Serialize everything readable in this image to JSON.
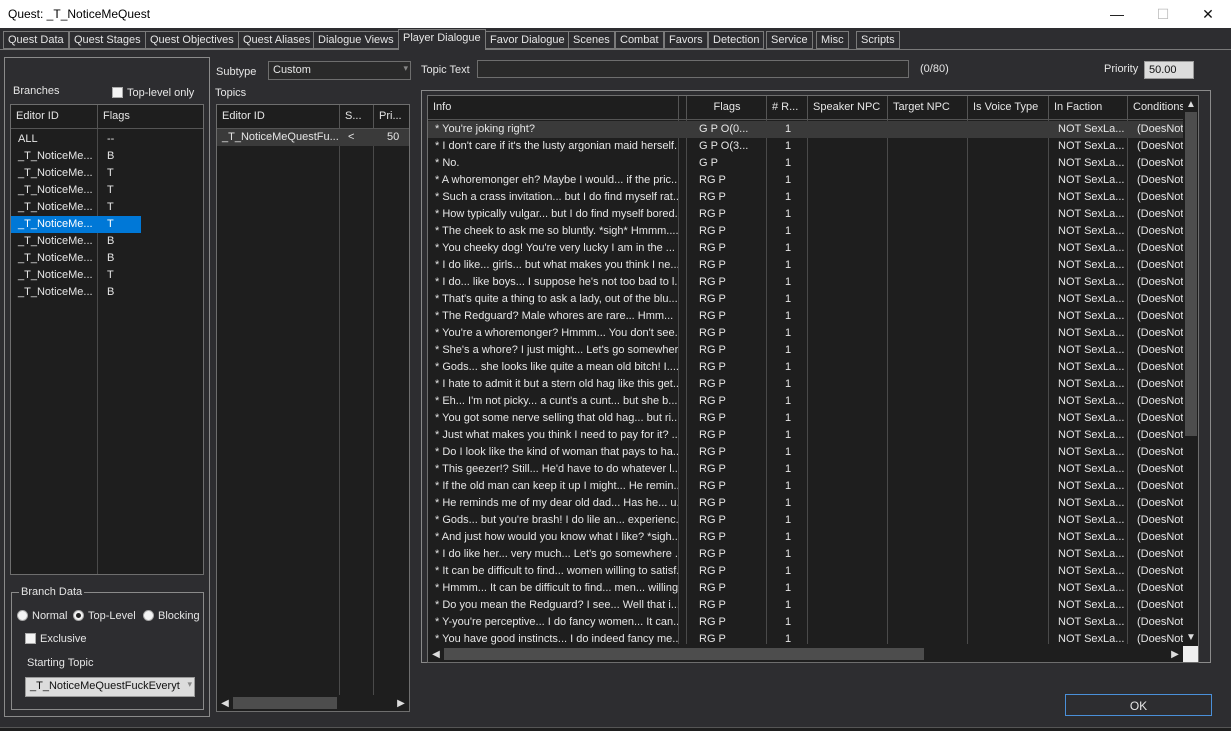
{
  "window": {
    "title": "Quest: _T_NoticeMeQuest",
    "minimize": "—",
    "maximize": "☐",
    "close": "✕"
  },
  "tabs": [
    {
      "label": "Quest Data"
    },
    {
      "label": "Quest Stages"
    },
    {
      "label": "Quest Objectives"
    },
    {
      "label": "Quest Aliases"
    },
    {
      "label": "Dialogue Views"
    },
    {
      "label": "Player Dialogue"
    },
    {
      "label": "Favor Dialogue"
    },
    {
      "label": "Scenes"
    },
    {
      "label": "Combat"
    },
    {
      "label": "Favors"
    },
    {
      "label": "Detection"
    },
    {
      "label": "Service"
    },
    {
      "label": "Misc"
    },
    {
      "label": "Scripts"
    }
  ],
  "branches": {
    "label": "Branches",
    "toplevel_only": "Top-level only",
    "headers": {
      "editor_id": "Editor ID",
      "flags": "Flags"
    },
    "rows": [
      {
        "id": "ALL",
        "flag": "--"
      },
      {
        "id": "_T_NoticeMe...",
        "flag": "B"
      },
      {
        "id": "_T_NoticeMe...",
        "flag": "T"
      },
      {
        "id": "_T_NoticeMe...",
        "flag": "T"
      },
      {
        "id": "_T_NoticeMe...",
        "flag": "T"
      },
      {
        "id": "_T_NoticeMe...",
        "flag": "T"
      },
      {
        "id": "_T_NoticeMe...",
        "flag": "B"
      },
      {
        "id": "_T_NoticeMe...",
        "flag": "B"
      },
      {
        "id": "_T_NoticeMe...",
        "flag": "T"
      },
      {
        "id": "_T_NoticeMe...",
        "flag": "B"
      }
    ],
    "selected_index": 5
  },
  "branch_data": {
    "label": "Branch Data",
    "normal": "Normal",
    "top_level": "Top-Level",
    "blocking": "Blocking",
    "exclusive": "Exclusive",
    "starting_topic_label": "Starting Topic",
    "starting_topic_value": "_T_NoticeMeQuestFuckEveryt"
  },
  "subtype": {
    "label": "Subtype",
    "value": "Custom"
  },
  "topic_text": {
    "label": "Topic Text",
    "value": "",
    "count": "(0/80)"
  },
  "priority": {
    "label": "Priority",
    "value": "50.00"
  },
  "topics": {
    "label": "Topics",
    "headers": {
      "editor_id": "Editor ID",
      "s": "S...",
      "pri": "Pri..."
    },
    "rows": [
      {
        "id": "_T_NoticeMeQuestFu...",
        "s": "<",
        "pri": "50"
      }
    ]
  },
  "info": {
    "headers": {
      "info": "Info",
      "flags": "Flags",
      "r": "# R...",
      "speaker": "Speaker NPC",
      "target": "Target NPC",
      "voice": "Is Voice Type",
      "faction": "In Faction",
      "conditions": "Conditions"
    },
    "rows": [
      {
        "info": "* You're joking right?",
        "flags": "G  P    O(0...",
        "r": "1",
        "faction": "NOT SexLa...",
        "cond": "(DoesNot"
      },
      {
        "info": "* I don't care if it's the lusty argonian maid herself....",
        "flags": "G  P    O(3...",
        "r": "1",
        "faction": "NOT SexLa...",
        "cond": "(DoesNot"
      },
      {
        "info": "* No.",
        "flags": "G  P",
        "r": "1",
        "faction": "NOT SexLa...",
        "cond": "(DoesNot"
      },
      {
        "info": "* A whoremonger eh? Maybe I would... if the pric...",
        "flags": "RG  P",
        "r": "1",
        "faction": "NOT SexLa...",
        "cond": "(DoesNot"
      },
      {
        "info": "* Such a crass invitation... but I do find myself rat...",
        "flags": "RG  P",
        "r": "1",
        "faction": "NOT SexLa...",
        "cond": "(DoesNot"
      },
      {
        "info": "* How typically vulgar... but I do find myself bored...",
        "flags": "RG  P",
        "r": "1",
        "faction": "NOT SexLa...",
        "cond": "(DoesNot"
      },
      {
        "info": "* The cheek to ask me so bluntly. *sigh* Hmmm......",
        "flags": "RG  P",
        "r": "1",
        "faction": "NOT SexLa...",
        "cond": "(DoesNot"
      },
      {
        "info": "* You cheeky dog! You're very lucky I am in the ...",
        "flags": "RG  P",
        "r": "1",
        "faction": "NOT SexLa...",
        "cond": "(DoesNot"
      },
      {
        "info": "* I do like... girls... but what makes you think I ne...",
        "flags": "RG  P",
        "r": "1",
        "faction": "NOT SexLa...",
        "cond": "(DoesNot"
      },
      {
        "info": "* I do... like boys... I suppose he's not too bad to l...",
        "flags": "RG  P",
        "r": "1",
        "faction": "NOT SexLa...",
        "cond": "(DoesNot"
      },
      {
        "info": "* That's quite a thing to ask a lady, out of the blu...",
        "flags": "RG  P",
        "r": "1",
        "faction": "NOT SexLa...",
        "cond": "(DoesNot"
      },
      {
        "info": "*  The Redguard? Male whores are rare...  Hmm...",
        "flags": "RG  P",
        "r": "1",
        "faction": "NOT SexLa...",
        "cond": "(DoesNot"
      },
      {
        "info": "* You're a whoremonger? Hmmm... You don't see...",
        "flags": "RG  P",
        "r": "1",
        "faction": "NOT SexLa...",
        "cond": "(DoesNot"
      },
      {
        "info": "* She's a whore? I just might... Let's go somewher...",
        "flags": "RG  P",
        "r": "1",
        "faction": "NOT SexLa...",
        "cond": "(DoesNot"
      },
      {
        "info": "* Gods... she looks like quite a mean old bitch! I.....",
        "flags": "RG  P",
        "r": "1",
        "faction": "NOT SexLa...",
        "cond": "(DoesNot"
      },
      {
        "info": "* I hate to admit it but a stern old hag like this get...",
        "flags": "RG  P",
        "r": "1",
        "faction": "NOT SexLa...",
        "cond": "(DoesNot"
      },
      {
        "info": "* Eh... I'm not picky... a cunt's a cunt... but she b...",
        "flags": "RG  P",
        "r": "1",
        "faction": "NOT SexLa...",
        "cond": "(DoesNot"
      },
      {
        "info": "* You got some nerve selling that old hag... but ri...",
        "flags": "RG  P",
        "r": "1",
        "faction": "NOT SexLa...",
        "cond": "(DoesNot"
      },
      {
        "info": "* Just what makes you think I need to pay for it? ...",
        "flags": "RG  P",
        "r": "1",
        "faction": "NOT SexLa...",
        "cond": "(DoesNot"
      },
      {
        "info": "* Do I look like the kind of woman that pays to ha...",
        "flags": "RG  P",
        "r": "1",
        "faction": "NOT SexLa...",
        "cond": "(DoesNot"
      },
      {
        "info": "* This geezer!? Still... He'd have to do whatever l...",
        "flags": "RG  P",
        "r": "1",
        "faction": "NOT SexLa...",
        "cond": "(DoesNot"
      },
      {
        "info": "* If the old man can keep it up I might... He remin...",
        "flags": "RG  P",
        "r": "1",
        "faction": "NOT SexLa...",
        "cond": "(DoesNot"
      },
      {
        "info": "* He reminds me of my dear old dad... Has he... u...",
        "flags": "RG  P",
        "r": "1",
        "faction": "NOT SexLa...",
        "cond": "(DoesNot"
      },
      {
        "info": "* Gods... but you're brash! I do lile an... experienc...",
        "flags": "RG  P",
        "r": "1",
        "faction": "NOT SexLa...",
        "cond": "(DoesNot"
      },
      {
        "info": "* And just how would you know what I like? *sigh...",
        "flags": "RG  P",
        "r": "1",
        "faction": "NOT SexLa...",
        "cond": "(DoesNot"
      },
      {
        "info": "* I do like her... very much... Let's go somewhere ...",
        "flags": "RG  P",
        "r": "1",
        "faction": "NOT SexLa...",
        "cond": "(DoesNot"
      },
      {
        "info": "* It can be difficult to find... women willing to satisf...",
        "flags": "RG  P",
        "r": "1",
        "faction": "NOT SexLa...",
        "cond": "(DoesNot"
      },
      {
        "info": "* Hmmm... It can be difficult to find... men... willing...",
        "flags": "RG  P",
        "r": "1",
        "faction": "NOT SexLa...",
        "cond": "(DoesNot"
      },
      {
        "info": "* Do you mean the Redguard? I see... Well that i...",
        "flags": "RG  P",
        "r": "1",
        "faction": "NOT SexLa...",
        "cond": "(DoesNot"
      },
      {
        "info": "* Y-you're perceptive... I do fancy women... It can...",
        "flags": "RG  P",
        "r": "1",
        "faction": "NOT SexLa...",
        "cond": "(DoesNot"
      },
      {
        "info": "* You have good instincts... I do indeed fancy me...",
        "flags": "RG  P",
        "r": "1",
        "faction": "NOT SexLa...",
        "cond": "(DoesNot"
      }
    ]
  },
  "ok_button": "OK",
  "icons": {
    "scroll_left": "◀",
    "scroll_right": "▶",
    "scroll_up": "▲",
    "scroll_down": "▼",
    "dropdown": "▾"
  }
}
